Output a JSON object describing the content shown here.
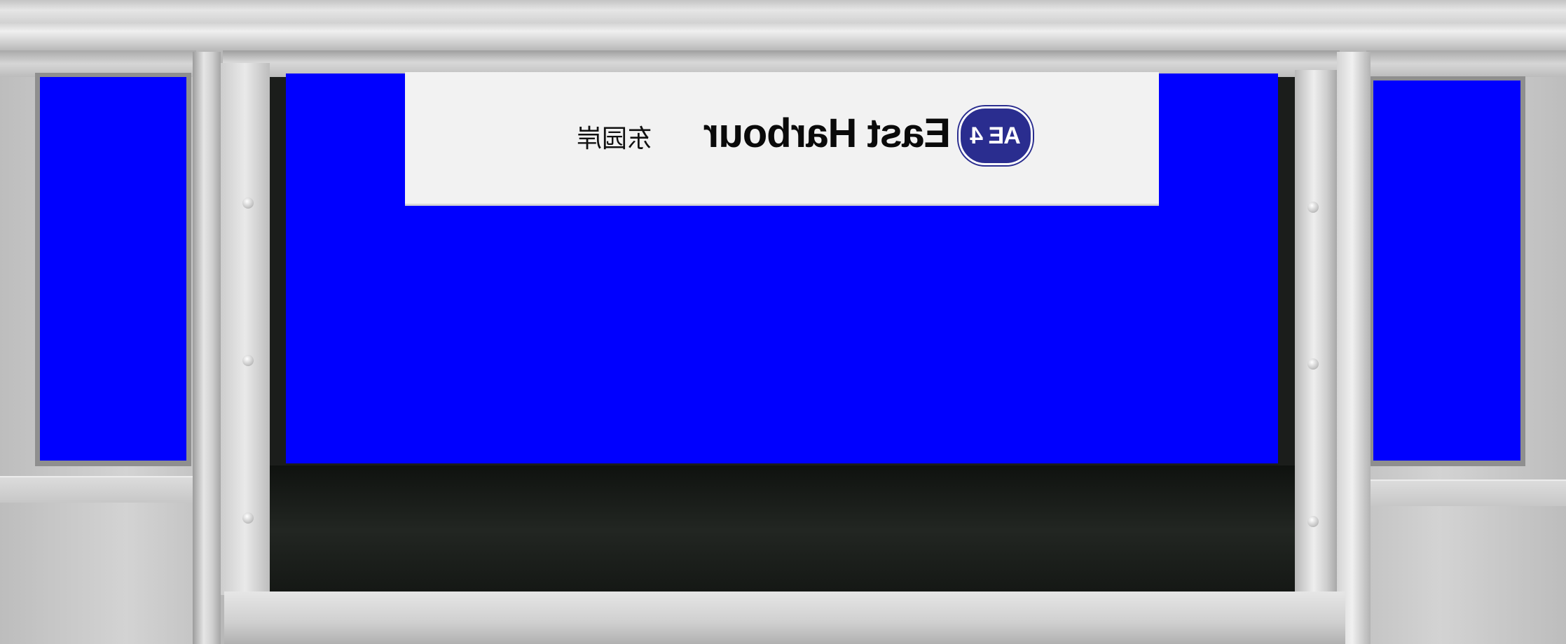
{
  "sign": {
    "line_badge": "AE 4",
    "station_name_en": "East Harbour",
    "station_name_cn": "东园岸",
    "mirrored": true,
    "badge_color": "#2a2d8f",
    "background_color": "#f2f2f2"
  },
  "screens": {
    "fill_color": "#0000ff"
  }
}
